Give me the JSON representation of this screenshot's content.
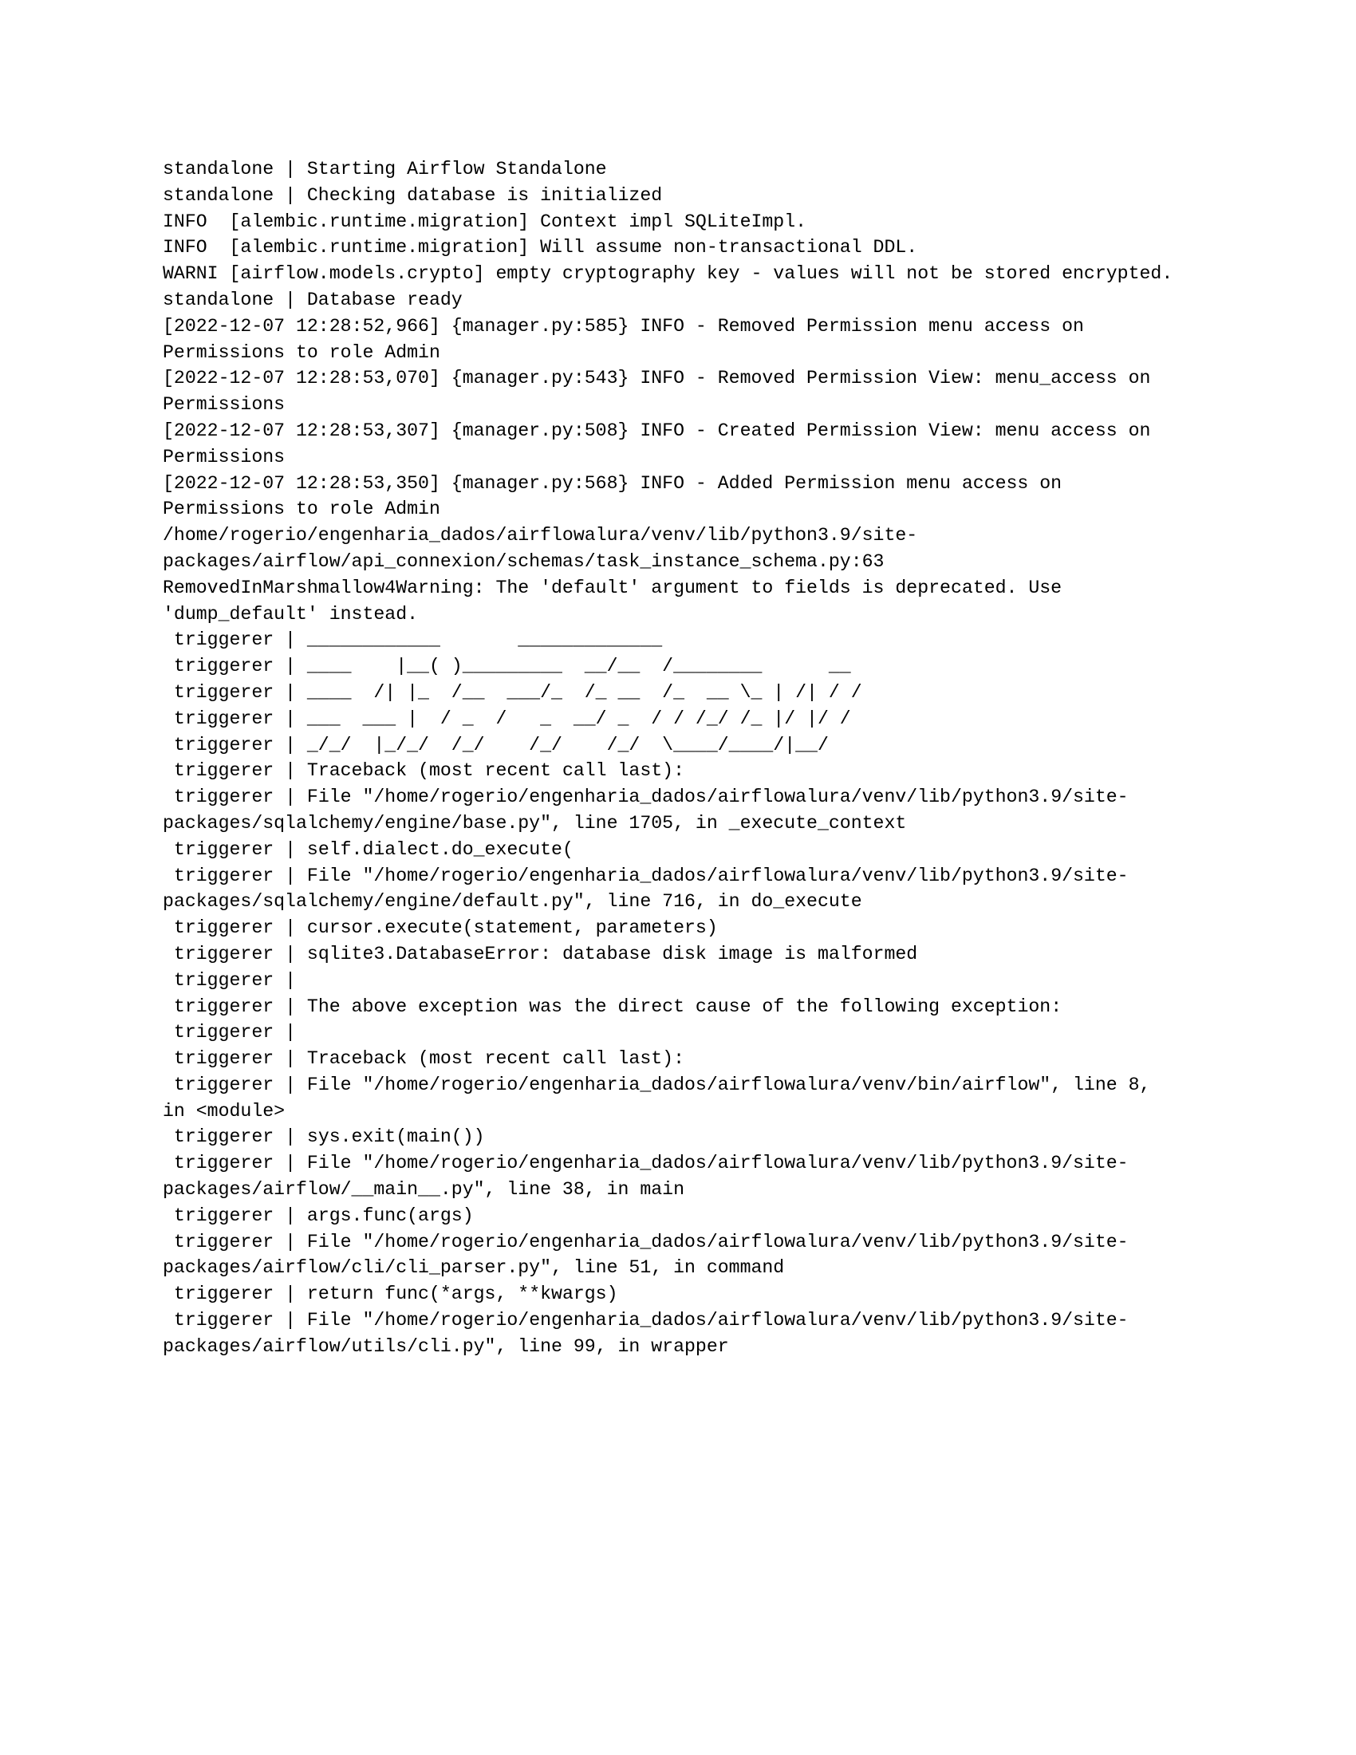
{
  "document": {
    "kind": "terminal-log-transcript",
    "title": "Airflow Standalone startup log with sqlite3 DatabaseError traceback",
    "background_color": "#ffffff",
    "text_color": "#000000"
  },
  "console": {
    "lines": [
      "standalone | Starting Airflow Standalone",
      "standalone | Checking database is initialized",
      "INFO  [alembic.runtime.migration] Context impl SQLiteImpl.",
      "INFO  [alembic.runtime.migration] Will assume non-transactional DDL.",
      "WARNI [airflow.models.crypto] empty cryptography key - values will not be stored encrypted.",
      "standalone | Database ready",
      "[2022-12-07 12:28:52,966] {manager.py:585} INFO - Removed Permission menu access on Permissions to role Admin",
      "[2022-12-07 12:28:53,070] {manager.py:543} INFO - Removed Permission View: menu_access on Permissions",
      "[2022-12-07 12:28:53,307] {manager.py:508} INFO - Created Permission View: menu access on Permissions",
      "[2022-12-07 12:28:53,350] {manager.py:568} INFO - Added Permission menu access on Permissions to role Admin",
      "/home/rogerio/engenharia_dados/airflowalura/venv/lib/python3.9/site-packages/airflow/api_connexion/schemas/task_instance_schema.py:63 RemovedInMarshmallow4Warning: The 'default' argument to fields is deprecated. Use 'dump_default' instead.",
      " triggerer | ____________       _____________",
      " triggerer | ____    |__( )_________  __/__  /________      __",
      " triggerer | ____  /| |_  /__  ___/_  /_ __  /_  __ \\_ | /| / /",
      " triggerer | ___  ___ |  / _  /   _  __/ _  / / /_/ /_ |/ |/ /",
      " triggerer | _/_/  |_/_/  /_/    /_/    /_/  \\____/____/|__/",
      " triggerer | Traceback (most recent call last):",
      " triggerer | File \"/home/rogerio/engenharia_dados/airflowalura/venv/lib/python3.9/site-packages/sqlalchemy/engine/base.py\", line 1705, in _execute_context",
      " triggerer | self.dialect.do_execute(",
      " triggerer | File \"/home/rogerio/engenharia_dados/airflowalura/venv/lib/python3.9/site-packages/sqlalchemy/engine/default.py\", line 716, in do_execute",
      " triggerer | cursor.execute(statement, parameters)",
      " triggerer | sqlite3.DatabaseError: database disk image is malformed",
      " triggerer |",
      " triggerer | The above exception was the direct cause of the following exception:",
      " triggerer |",
      " triggerer | Traceback (most recent call last):",
      " triggerer | File \"/home/rogerio/engenharia_dados/airflowalura/venv/bin/airflow\", line 8, in <module>",
      " triggerer | sys.exit(main())",
      " triggerer | File \"/home/rogerio/engenharia_dados/airflowalura/venv/lib/python3.9/site-packages/airflow/__main__.py\", line 38, in main",
      " triggerer | args.func(args)",
      " triggerer | File \"/home/rogerio/engenharia_dados/airflowalura/venv/lib/python3.9/site-packages/airflow/cli/cli_parser.py\", line 51, in command",
      " triggerer | return func(*args, **kwargs)",
      " triggerer | File \"/home/rogerio/engenharia_dados/airflowalura/venv/lib/python3.9/site-packages/airflow/utils/cli.py\", line 99, in wrapper"
    ],
    "ascii_banner_line_indices": [
      11,
      12,
      13,
      14,
      15
    ]
  }
}
